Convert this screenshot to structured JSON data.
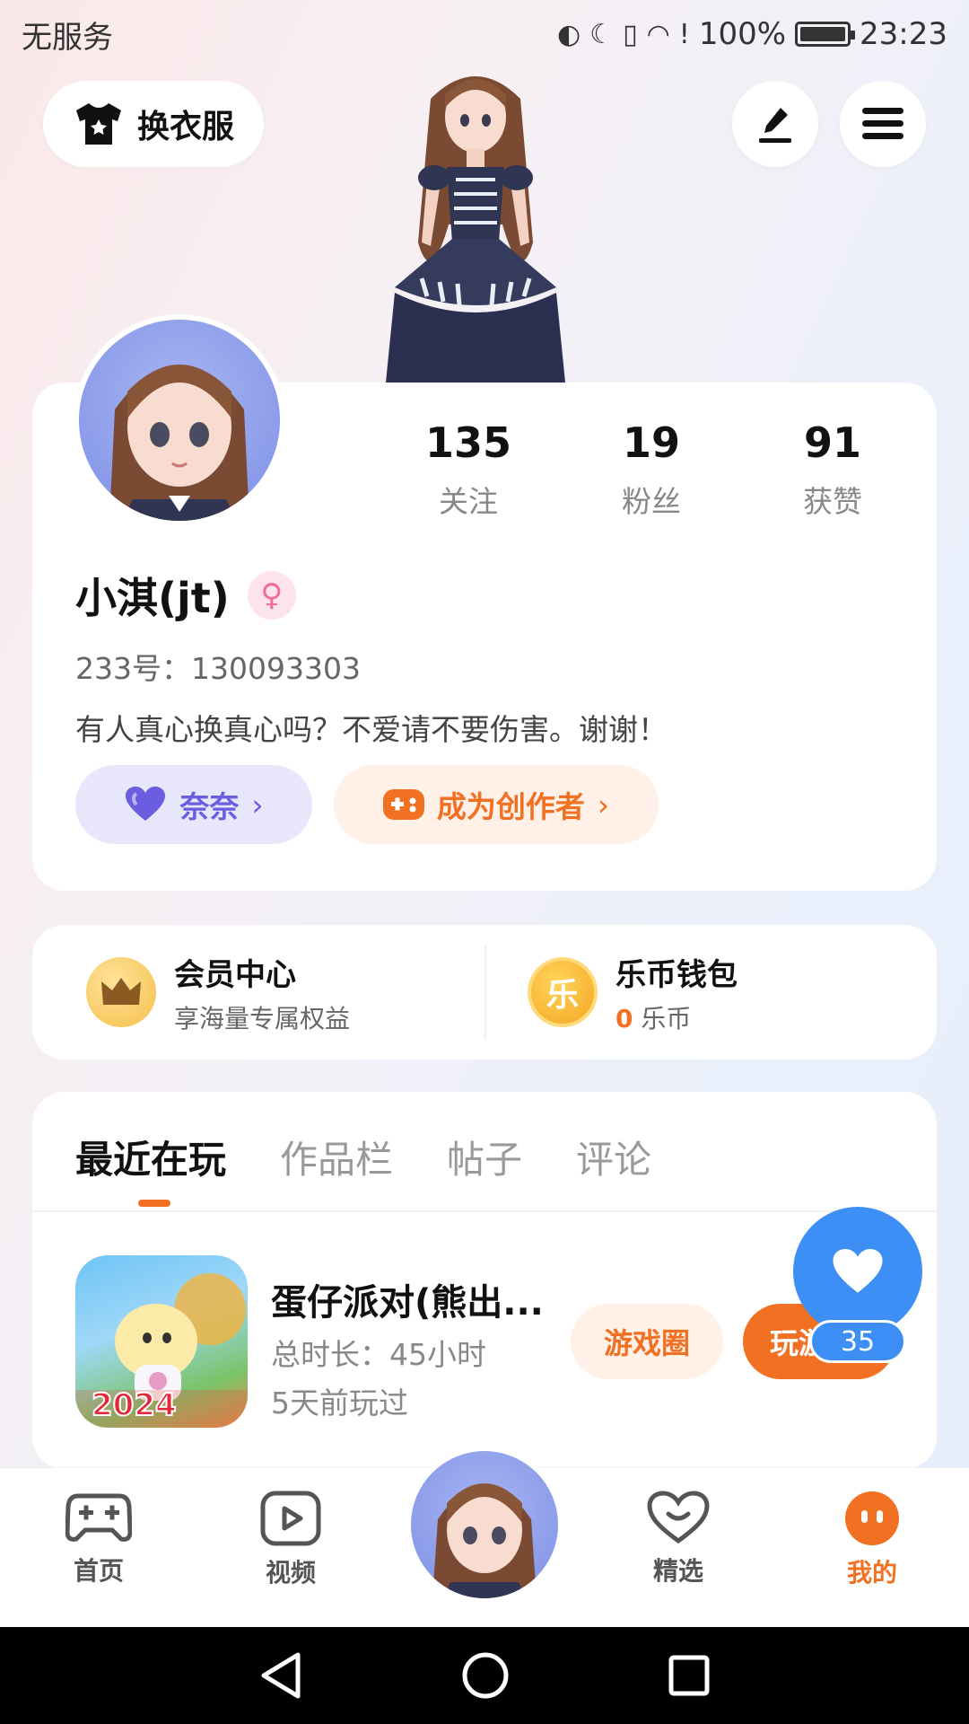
{
  "status_bar": {
    "carrier": "无服务",
    "battery": "100%",
    "time": "23:23"
  },
  "header": {
    "outfit_label": "换衣服"
  },
  "profile": {
    "stats": [
      {
        "value": "135",
        "label": "关注"
      },
      {
        "value": "19",
        "label": "粉丝"
      },
      {
        "value": "91",
        "label": "获赞"
      }
    ],
    "name": "小淇(jt)",
    "gender_symbol": "♀",
    "uid": "233号：130093303",
    "bio": "有人真心换真心吗？不爱请不要伤害。谢谢！",
    "tag_nana": "奈奈",
    "tag_creator": "成为创作者"
  },
  "member": {
    "vip_title": "会员中心",
    "vip_sub": "享海量专属权益",
    "wallet_icon_text": "乐",
    "wallet_title": "乐币钱包",
    "wallet_amount": "0",
    "wallet_unit": "乐币"
  },
  "content": {
    "tabs": [
      "最近在玩",
      "作品栏",
      "帖子",
      "评论"
    ],
    "game": {
      "title": "蛋仔派对(熊出...",
      "duration": "总时长：45小时",
      "last_played": "5天前玩过",
      "badge": "2024",
      "circle_btn": "游戏圈",
      "play_btn": "玩游"
    }
  },
  "like_count": "35",
  "bottom_nav": {
    "items": [
      "首页",
      "视频",
      "精选",
      "我的"
    ]
  },
  "colors": {
    "accent": "#f27022",
    "blue": "#3d8ef5",
    "purple": "#6b5de0"
  }
}
